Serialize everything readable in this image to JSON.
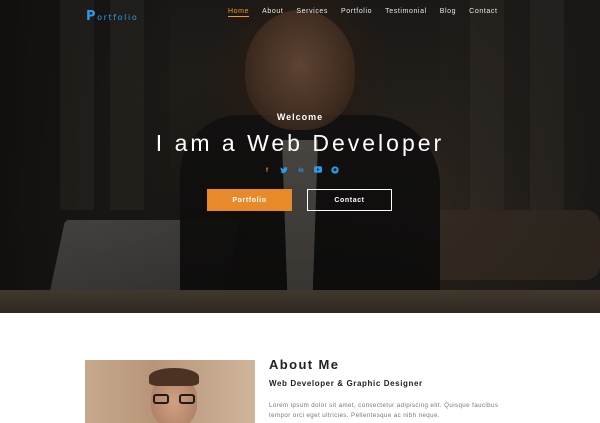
{
  "brand": {
    "initial": "P",
    "rest": "ortfolio",
    "color": "#2e9be8"
  },
  "nav": {
    "items": [
      {
        "label": "Home",
        "active": true
      },
      {
        "label": "About"
      },
      {
        "label": "Services"
      },
      {
        "label": "Portfolio"
      },
      {
        "label": "Testimonial"
      },
      {
        "label": "Blog"
      },
      {
        "label": "Contact"
      }
    ],
    "active_color": "#f19a2a"
  },
  "hero": {
    "welcome": "Welcome",
    "headline": "I am a Web Developer",
    "socials": [
      {
        "icon": "facebook-icon",
        "glyph": "f",
        "color": "#e8892a"
      },
      {
        "icon": "twitter-icon",
        "glyph": "🐦",
        "color": "#2e9be8"
      },
      {
        "icon": "linkedin-icon",
        "glyph": "in",
        "color": "#2e9be8"
      },
      {
        "icon": "youtube-icon",
        "glyph": "▶",
        "color": "#2e9be8"
      },
      {
        "icon": "github-icon",
        "glyph": "●",
        "color": "#2e9be8"
      }
    ],
    "primary_button": "Portfolio",
    "secondary_button": "Contact",
    "accent_color": "#e8892a"
  },
  "about": {
    "title": "About Me",
    "subtitle": "Web Developer & Graphic Designer",
    "text": "Lorem ipsum dolor sit amet, consectetur adipiscing elit. Quisque faucibus tempor orci eget ultricies. Pellentesque ac nibh neque."
  }
}
